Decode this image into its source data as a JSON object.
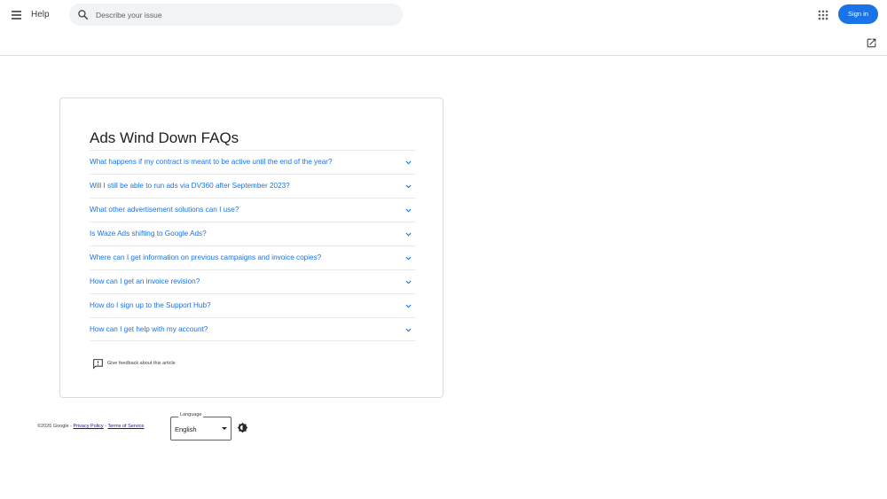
{
  "header": {
    "menu_icon": "menu-icon",
    "app_title": "Help",
    "search_placeholder": "Describe your issue",
    "search_icon": "search-icon",
    "apps_icon": "apps-grid-icon",
    "signin_label": "Sign in",
    "open_new_icon": "open-in-new-icon"
  },
  "article": {
    "title": "Ads Wind Down FAQs",
    "faqs": [
      "What happens if my contract is meant to be active until the end of the year?",
      "Will I still be able to run ads via DV360 after September 2023?",
      "What other advertisement solutions can I use?",
      "Is Waze Ads shifting to Google Ads?",
      "Where can I get information on previous campaigns and invoice copies?",
      "How can I get an invoice revision?",
      "How do I sign up to the Support Hub?",
      "How can I get help with my account?"
    ],
    "feedback_label": "Give feedback about this article",
    "feedback_icon": "feedback-icon"
  },
  "footer": {
    "copyright": "©2026 Google - ",
    "privacy": "Privacy Policy",
    "separator": " - ",
    "terms": "Terms of Service",
    "language_label": "Language",
    "language_value": "English",
    "theme_icon": "brightness-icon"
  },
  "colors": {
    "accent": "#1a73e8",
    "link": "#1a0dab",
    "border": "#dadce0"
  }
}
